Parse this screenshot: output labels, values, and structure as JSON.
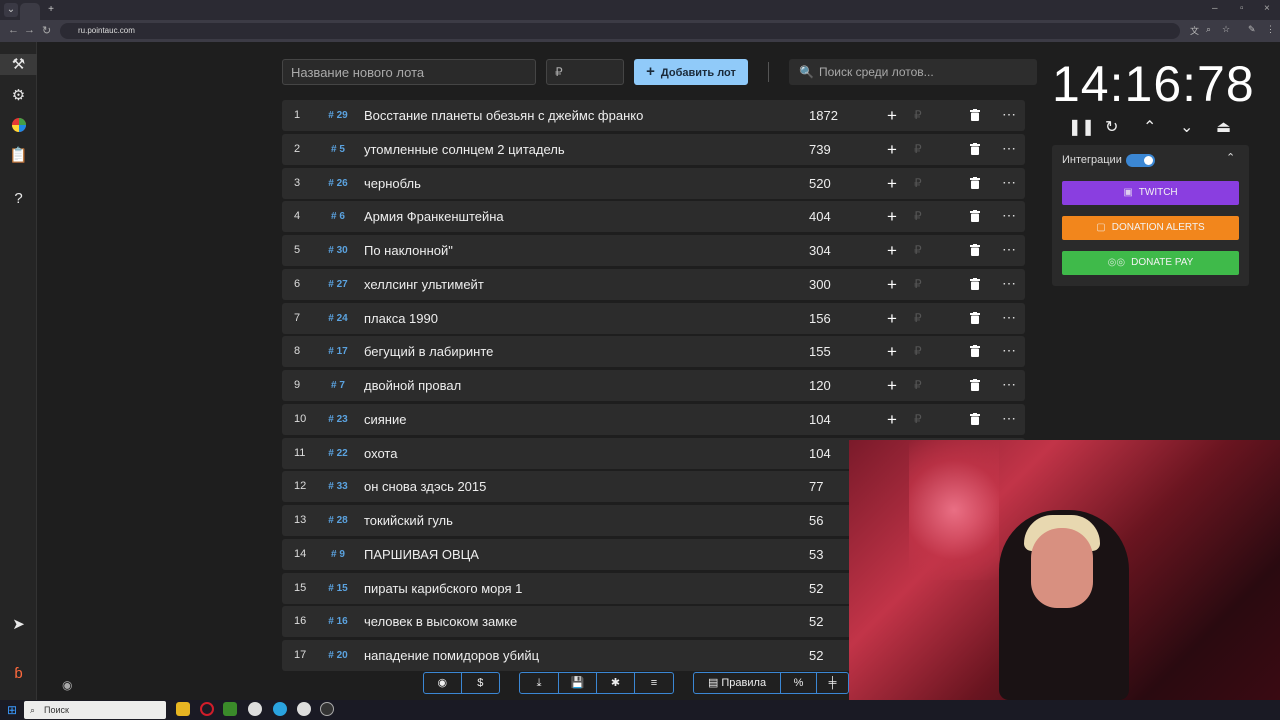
{
  "browser": {
    "url": "ru.pointauc.com",
    "minimize": "–",
    "maximize": "▫",
    "close": "×"
  },
  "toolbar": {
    "lot_name_placeholder": "Название нового лота",
    "price_placeholder": "₽",
    "add_lot_label": "Добавить лот",
    "search_placeholder": "Поиск среди лотов..."
  },
  "lots": [
    {
      "index": "1",
      "id": "# 29",
      "name": "Восстание планеты обезьян с джеймс франко",
      "amount": "1872"
    },
    {
      "index": "2",
      "id": "# 5",
      "name": "утомленные солнцем 2 цитадель",
      "amount": "739"
    },
    {
      "index": "3",
      "id": "# 26",
      "name": "чернобль",
      "amount": "520"
    },
    {
      "index": "4",
      "id": "# 6",
      "name": "Армия Франкенштейна",
      "amount": "404"
    },
    {
      "index": "5",
      "id": "# 30",
      "name": "По наклонной\"",
      "amount": "304"
    },
    {
      "index": "6",
      "id": "# 27",
      "name": "хеллсинг ультимейт",
      "amount": "300"
    },
    {
      "index": "7",
      "id": "# 24",
      "name": "плакса 1990",
      "amount": "156"
    },
    {
      "index": "8",
      "id": "# 17",
      "name": "бегущий в лабиринте",
      "amount": "155"
    },
    {
      "index": "9",
      "id": "# 7",
      "name": " двойной провал",
      "amount": "120"
    },
    {
      "index": "10",
      "id": "# 23",
      "name": "сияние",
      "amount": "104"
    },
    {
      "index": "11",
      "id": "# 22",
      "name": "охота",
      "amount": "104"
    },
    {
      "index": "12",
      "id": "# 33",
      "name": "он снова здэсь 2015",
      "amount": "77"
    },
    {
      "index": "13",
      "id": "# 28",
      "name": "токийский гуль",
      "amount": "56"
    },
    {
      "index": "14",
      "id": "# 9",
      "name": "ПАРШИВАЯ ОВЦА",
      "amount": "53"
    },
    {
      "index": "15",
      "id": "# 15",
      "name": "пираты карибского моря 1",
      "amount": "52"
    },
    {
      "index": "16",
      "id": "# 16",
      "name": "человек в высоком замке",
      "amount": "52"
    },
    {
      "index": "17",
      "id": "# 20",
      "name": "нападение помидоров убийц",
      "amount": "52"
    }
  ],
  "row_actions": {
    "plus": "+",
    "rub": "₽",
    "more": "⋯"
  },
  "timer": {
    "display": "14:16:78"
  },
  "integrations": {
    "title": "Интеграции",
    "twitch_label": "TWITCH",
    "donation_alerts_label": "DONATION ALERTS",
    "donate_pay_label": "DONATE PAY",
    "colors": {
      "twitch": "#8a3ee0",
      "donation_alerts": "#f2861c",
      "donate_pay": "#3fba4a"
    }
  },
  "bottom": {
    "rules_label": "Правила",
    "percent_label": "%",
    "dollar_label": "$"
  },
  "taskbar": {
    "search_placeholder": "Поиск"
  },
  "accent": "#90caf9"
}
